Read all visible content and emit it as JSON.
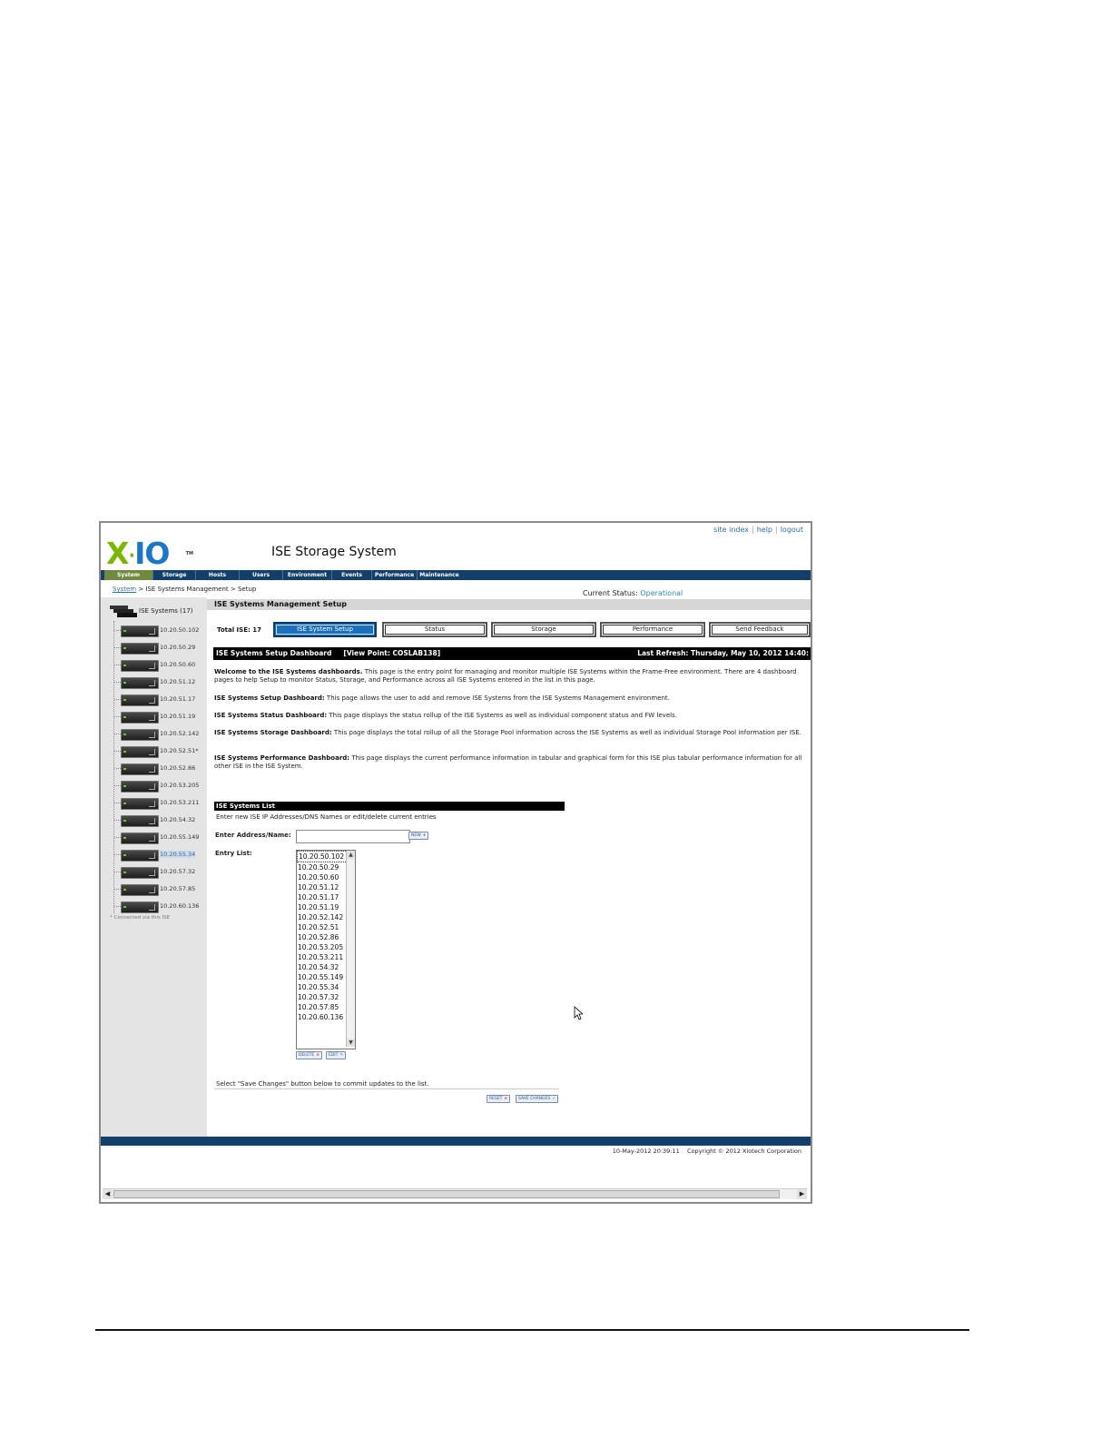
{
  "top_links": [
    "site index",
    "help",
    "logout"
  ],
  "logo": {
    "x": "X",
    "dot": "·",
    "io": "IO",
    "tm": "TM"
  },
  "app_title": "ISE Storage System",
  "nav_tabs": [
    "System",
    "Storage",
    "Hosts",
    "Users",
    "Environment",
    "Events",
    "Performance",
    "Maintenance"
  ],
  "breadcrumb": {
    "root": "System",
    "rest": " > ISE Systems Management > Setup"
  },
  "current_status": {
    "label": "Current Status: ",
    "value": "Operational"
  },
  "tree": {
    "root_label": "ISE Systems (17)",
    "nodes": [
      "10.20.50.102",
      "10.20.50.29",
      "10.20.50.60",
      "10.20.51.12",
      "10.20.51.17",
      "10.20.51.19",
      "10.20.52.142",
      "10.20.52.51*",
      "10.20.52.86",
      "10.20.53.205",
      "10.20.53.211",
      "10.20.54.32",
      "10.20.55.149",
      "10.20.55.34",
      "10.20.57.32",
      "10.20.57.85",
      "10.20.60.136"
    ],
    "selected": "10.20.55.34",
    "footnote": "* Connected via this ISE"
  },
  "section_title": "ISE Systems Management Setup",
  "total_ise": "Total ISE: 17",
  "dashboard_buttons": [
    "ISE System Setup",
    "Status",
    "Storage",
    "Performance",
    "Send Feedback"
  ],
  "dash_bar": {
    "left": "ISE Systems Setup Dashboard     [View Point: COSLAB138]",
    "right": "Last Refresh: Thursday, May 10, 2012 14:40:"
  },
  "paragraphs": [
    {
      "bold": "Welcome to the ISE Systems dashboards.",
      "text": " This page is the entry point for managing and monitor multiple ISE Systems within the Frame-Free environment. There are 4 dashboard pages to help Setup to monitor Status, Storage, and Performance across all ISE Systems entered in the list in this page."
    },
    {
      "bold": "ISE Systems Setup Dashboard:",
      "text": " This page allows the user to add and remove ISE Systems from the ISE Systems Management environment."
    },
    {
      "bold": "ISE Systems Status Dashboard:",
      "text": " This page displays the status rollup of the ISE Systems as well as individual component status and FW levels."
    },
    {
      "bold": "ISE Systems Storage Dashboard:",
      "text": " This page displays the total rollup of all the Storage Pool information across the ISE Systems as well as individual Storage Pool information per ISE."
    },
    {
      "bold": "ISE Systems Performance Dashboard:",
      "text": " This page displays the current performance information in tabular and graphical form for this ISE plus tabular performance information for all other ISE in the ISE System."
    }
  ],
  "list_section": {
    "title": "ISE Systems List",
    "instruction": "Enter new ISE IP Addresses/DNS Names or edit/delete current entries",
    "address_label": "Enter Address/Name:",
    "address_value": "",
    "new_button": "NEW",
    "entry_label": "Entry List:",
    "entries": [
      "10.20.50.102",
      "10.20.50.29",
      "10.20.50.60",
      "10.20.51.12",
      "10.20.51.17",
      "10.20.51.19",
      "10.20.52.142",
      "10.20.52.51",
      "10.20.52.86",
      "10.20.53.205",
      "10.20.53.211",
      "10.20.54.32",
      "10.20.55.149",
      "10.20.55.34",
      "10.20.57.32",
      "10.20.57.85",
      "10.20.60.136"
    ],
    "delete_button": "DELETE",
    "edit_button": "EDIT",
    "save_note": "Select \"Save Changes\" button below to commit updates to the list.",
    "reset_button": "RESET",
    "save_button": "SAVE CHANGES"
  },
  "footer": {
    "datetime": "10-May-2012 20:39:11",
    "copyright": "Copyright © 2012  Xiotech Corporation"
  }
}
